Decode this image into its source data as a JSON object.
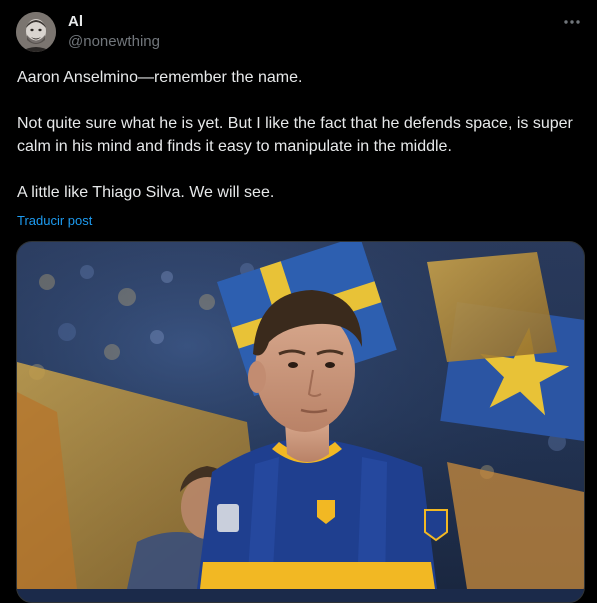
{
  "post": {
    "author": {
      "display_name": "Al",
      "handle": "@nonewthing",
      "avatar_icon": "user-avatar-photo"
    },
    "more_icon": "more-horizontal-icon",
    "text": {
      "paragraph_1": "Aaron Anselmino—remember the name.",
      "paragraph_2": "Not quite sure what he is yet. But I like the fact that he defends space, is super calm in his mind and finds it easy to manipulate in the middle.",
      "paragraph_3": "A little like Thiago Silva. We will see."
    },
    "translate_label": "Traducir post",
    "media": {
      "kind": "photo",
      "subject": "football player in blue and yellow kit",
      "jersey_badge": "CABJ"
    }
  },
  "colors": {
    "background": "#000000",
    "primary_text": "#e7e9ea",
    "secondary_text": "#71767b",
    "link": "#1d9bf0",
    "border": "#2f3336",
    "kit_blue": "#1f3f8f",
    "kit_yellow": "#f2b823"
  }
}
